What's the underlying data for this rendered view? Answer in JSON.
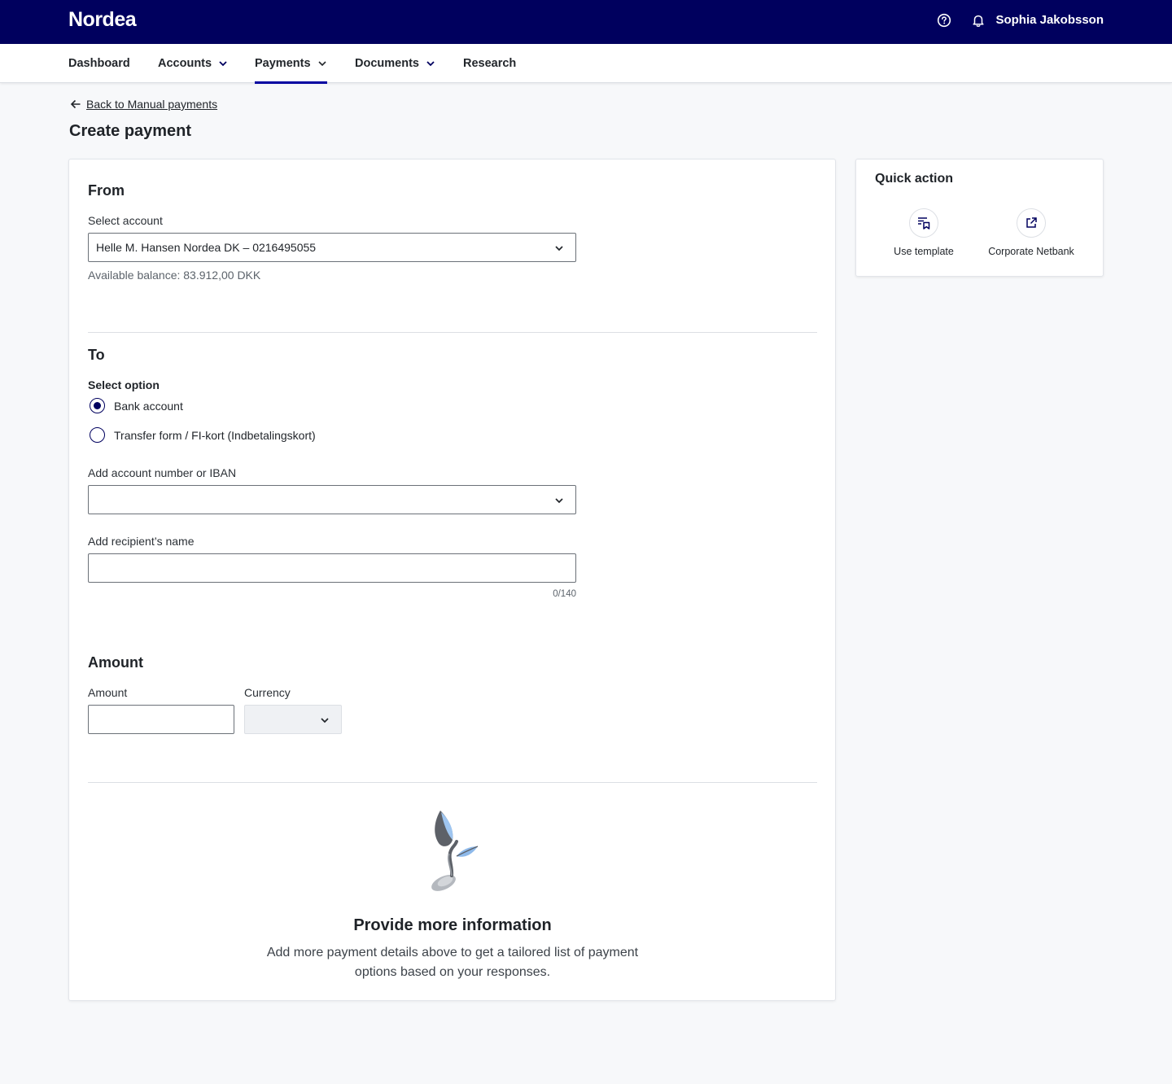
{
  "header": {
    "logo": "Nordea",
    "user_name": "Sophia Jakobsson",
    "icons": [
      "help-icon",
      "bell-icon"
    ]
  },
  "nav": {
    "items": [
      {
        "label": "Dashboard",
        "has_dropdown": false
      },
      {
        "label": "Accounts",
        "has_dropdown": true
      },
      {
        "label": "Payments",
        "has_dropdown": true,
        "active": true
      },
      {
        "label": "Documents",
        "has_dropdown": true
      },
      {
        "label": "Research",
        "has_dropdown": false
      }
    ]
  },
  "breadcrumb": {
    "back_label": "Back to Manual payments"
  },
  "page": {
    "title": "Create payment"
  },
  "from": {
    "title": "From",
    "select_label": "Select account",
    "selected_account": "Helle M. Hansen Nordea DK – 0216495055",
    "balance_text": "Available balance: 83.912,00 DKK"
  },
  "to": {
    "title": "To",
    "option_label": "Select option",
    "options": [
      {
        "label": "Bank account",
        "checked": true
      },
      {
        "label": "Transfer form / FI-kort (Indbetalingskort)",
        "checked": false
      }
    ],
    "account_label": "Add account number or IBAN",
    "account_value": "",
    "name_label": "Add recipient’s name",
    "name_value": "",
    "name_counter": "0/140"
  },
  "amount": {
    "title": "Amount",
    "amount_label": "Amount",
    "amount_value": "",
    "currency_label": "Currency",
    "currency_value": ""
  },
  "empty_state": {
    "title": "Provide more information",
    "line1": "Add more payment details above to get a tailored list of payment",
    "line2": "options based on your responses."
  },
  "quick_action": {
    "title": "Quick action",
    "items": [
      {
        "label": "Use template",
        "icon": "template-icon"
      },
      {
        "label": "Corporate Netbank",
        "icon": "external-link-icon"
      }
    ]
  },
  "colors": {
    "brand_navy": "#00005e",
    "accent_blue": "#0000a0",
    "page_bg": "#f7f8fa"
  }
}
